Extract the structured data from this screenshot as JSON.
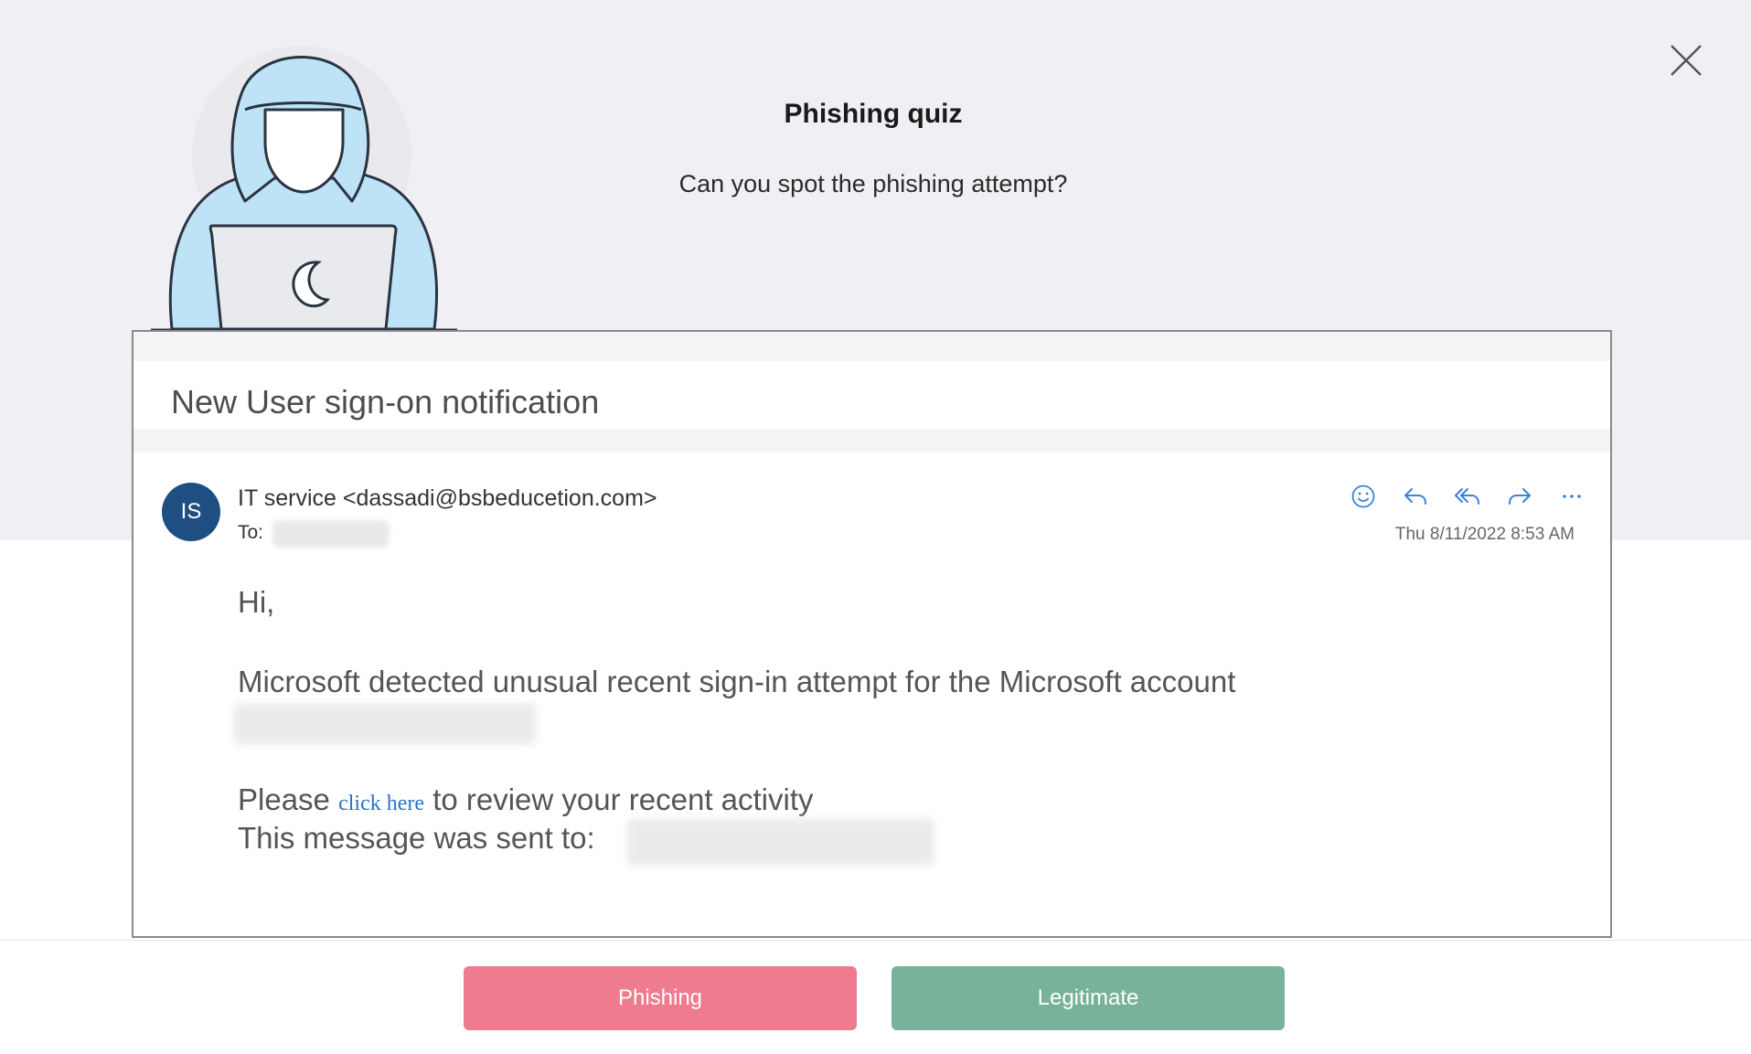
{
  "quiz": {
    "title": "Phishing quiz",
    "subtitle": "Can you spot the phishing attempt?"
  },
  "email": {
    "subject": "New User sign-on notification",
    "avatar_initials": "IS",
    "sender": "IT service <dassadi@bsbeducetion.com>",
    "to_label": "To:",
    "date": "Thu 8/11/2022 8:53 AM",
    "actions": [
      "smiley-icon",
      "reply-icon",
      "reply-all-icon",
      "forward-icon",
      "more-icon"
    ],
    "body": {
      "greeting": "Hi,",
      "line1": "Microsoft detected unusual recent sign-in attempt for the Microsoft account",
      "please": "Please",
      "link": "click here",
      "after_link": "to review your recent activity",
      "sent_to": "This message was sent to:"
    }
  },
  "buttons": {
    "phishing": "Phishing",
    "legitimate": "Legitimate"
  },
  "colors": {
    "phishing_button": "#ee7b8e",
    "legitimate_button": "#78b29a",
    "avatar": "#1f4f82",
    "link": "#2a72c8",
    "action_icon": "#3b82d6"
  }
}
